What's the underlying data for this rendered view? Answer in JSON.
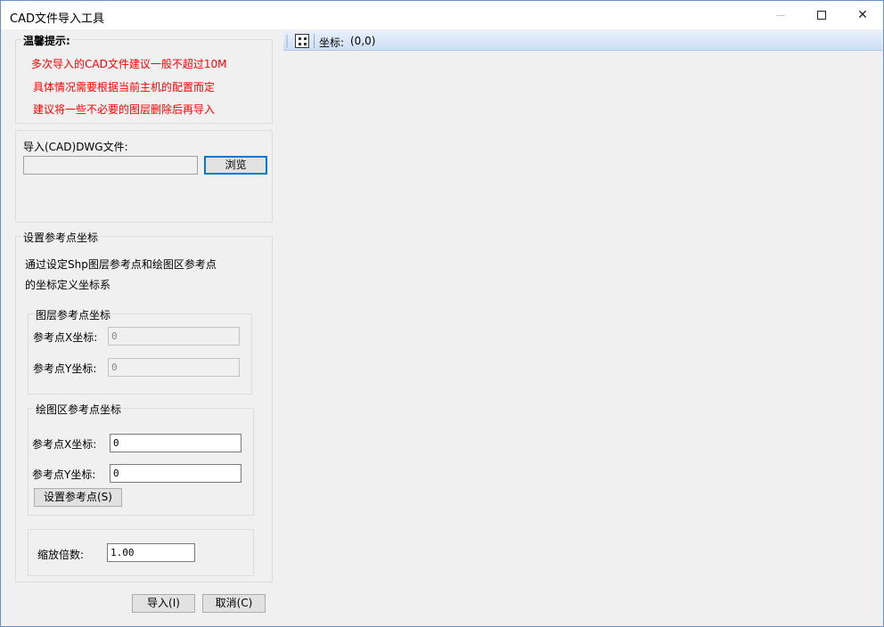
{
  "window": {
    "title": "CAD文件导入工具"
  },
  "tips": {
    "title": "温馨提示:",
    "lines": [
      "多次导入的CAD文件建议一般不超过10M",
      "具体情况需要根据当前主机的配置而定",
      "建议将一些不必要的图层删除后再导入"
    ]
  },
  "import": {
    "label": "导入(CAD)DWG文件:",
    "path_value": "",
    "browse_label": "浏览"
  },
  "ref": {
    "title": "设置参考点坐标",
    "description_1": "通过设定Shp图层参考点和绘图区参考点",
    "description_2": "的坐标定义坐标系",
    "layer_group": {
      "title": "图层参考点坐标",
      "x_label": "参考点X坐标:",
      "x_value": "0",
      "y_label": "参考点Y坐标:",
      "y_value": "0"
    },
    "draw_group": {
      "title": "绘图区参考点坐标",
      "x_label": "参考点X坐标:",
      "x_value": "0",
      "y_label": "参考点Y坐标:",
      "y_value": "0",
      "set_button": "设置参考点(S)"
    },
    "scale_label": "缩放倍数:",
    "scale_value": "1.00"
  },
  "buttons": {
    "import": "导入(I)",
    "cancel": "取消(C)"
  },
  "toolbar": {
    "coord_label": "坐标:",
    "coord_value": "(0,0)"
  }
}
